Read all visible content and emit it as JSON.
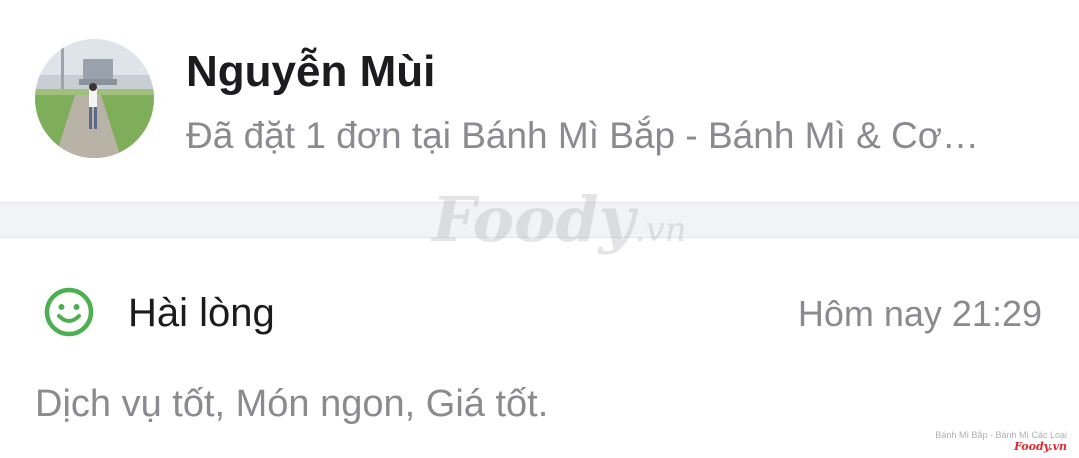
{
  "review": {
    "user_name": "Nguyễn Mùi",
    "order_description": "Đã đặt 1 đơn tại Bánh Mì Bắp - Bánh Mì & Cơ…",
    "rating_label": "Hài lòng",
    "time": "Hôm nay 21:29",
    "text": "Dịch vụ tốt, Món ngon, Giá tốt.",
    "rating_icon": "smiley-icon"
  },
  "watermark": {
    "brand": "Foody",
    "suffix": ".vn"
  },
  "corner_credit": {
    "text": "Bánh Mì Bắp - Bánh Mì Các Loại",
    "logo": "Foody.vn"
  },
  "colors": {
    "accent_green": "#4caf50",
    "name_text": "#1c1c1e",
    "secondary_text": "#8a8a8f",
    "separator": "#f2f3f7",
    "logo_red": "#e0282e"
  }
}
